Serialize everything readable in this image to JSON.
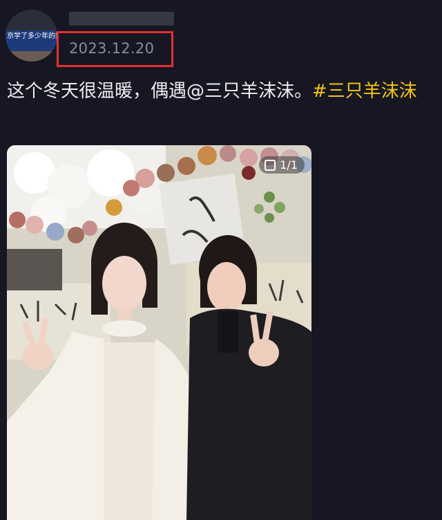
{
  "post": {
    "avatar_text": "京学了多少年的舞蹈",
    "date": "2023.12.20",
    "text_main": "这个冬天很温暖，偶遇@三只羊沫沫。",
    "hashtag": "#三只羊沫沫",
    "photo_counter": "1/1"
  },
  "colors": {
    "background": "#161722",
    "hashtag": "#f5c518",
    "highlight_box": "#e5312f",
    "date": "#8b8d99"
  }
}
